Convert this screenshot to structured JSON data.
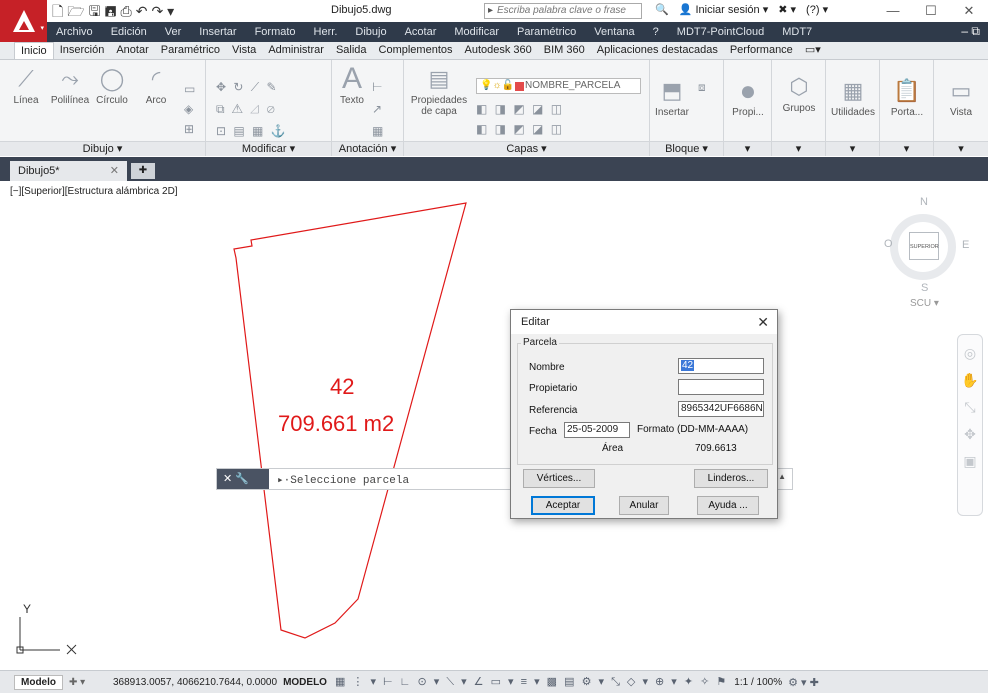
{
  "title_bar": {
    "doc_title": "Dibujo5.dwg",
    "search_placeholder": "Escriba palabra clave o frase",
    "signin": "Iniciar sesión",
    "help": "?"
  },
  "menu": [
    "Archivo",
    "Edición",
    "Ver",
    "Insertar",
    "Formato",
    "Herr.",
    "Dibujo",
    "Acotar",
    "Modificar",
    "Paramétrico",
    "Ventana",
    "?",
    "MDT7-PointCloud",
    "MDT7"
  ],
  "ribbon_tabs": [
    "Inicio",
    "Inserción",
    "Anotar",
    "Paramétrico",
    "Vista",
    "Administrar",
    "Salida",
    "Complementos",
    "Autodesk 360",
    "BIM 360",
    "Aplicaciones destacadas",
    "Performance"
  ],
  "ribbon": {
    "tools": {
      "linea": "Línea",
      "polilinea": "Polilínea",
      "circulo": "Círculo",
      "arco": "Arco",
      "texto": "Texto",
      "propiedades_capa": "Propiedades de capa",
      "insertar": "Insertar",
      "propi": "Propi...",
      "grupos": "Grupos",
      "utilidades": "Utilidades",
      "porta": "Porta...",
      "vista": "Vista"
    },
    "layer_name": "NOMBRE_PARCELA",
    "panels": {
      "dibujo": "Dibujo ▾",
      "modificar": "Modificar ▾",
      "anotacion": "Anotación ▾",
      "capas": "Capas ▾",
      "bloque": "Bloque ▾"
    }
  },
  "doc_tab": "Dibujo5*",
  "viewport_label": "[−][Superior][Estructura alámbrica 2D]",
  "viewcube": {
    "n": "N",
    "s": "S",
    "e": "E",
    "w": "O",
    "face": "SUPERIOR",
    "ucs": "SCU ▾"
  },
  "parcel": {
    "name": "42",
    "area": "709.661 m2"
  },
  "ucs_label": "Y",
  "command_line": {
    "prompt": "Seleccione parcela"
  },
  "status_bar": {
    "model_tab": "Modelo",
    "coords": "368913.0057, 4066210.7644, 0.0000",
    "space": "MODELO",
    "scale": "1:1 / 100%"
  },
  "dialog": {
    "title": "Editar",
    "group": "Parcela",
    "labels": {
      "nombre": "Nombre",
      "propietario": "Propietario",
      "referencia": "Referencia",
      "fecha": "Fecha",
      "formato": "Formato (DD-MM-AAAA)",
      "area": "Área"
    },
    "values": {
      "nombre": "42",
      "propietario": "",
      "referencia": "8965342UF6686N",
      "fecha": "25-05-2009",
      "area": "709.6613"
    },
    "buttons": {
      "vertices": "Vértices...",
      "linderos": "Linderos...",
      "aceptar": "Aceptar",
      "anular": "Anular",
      "ayuda": "Ayuda ..."
    }
  },
  "colors": {
    "parcel_red": "#e01919",
    "menu_dark": "#2f3a4a",
    "logo_red": "#c62127"
  }
}
